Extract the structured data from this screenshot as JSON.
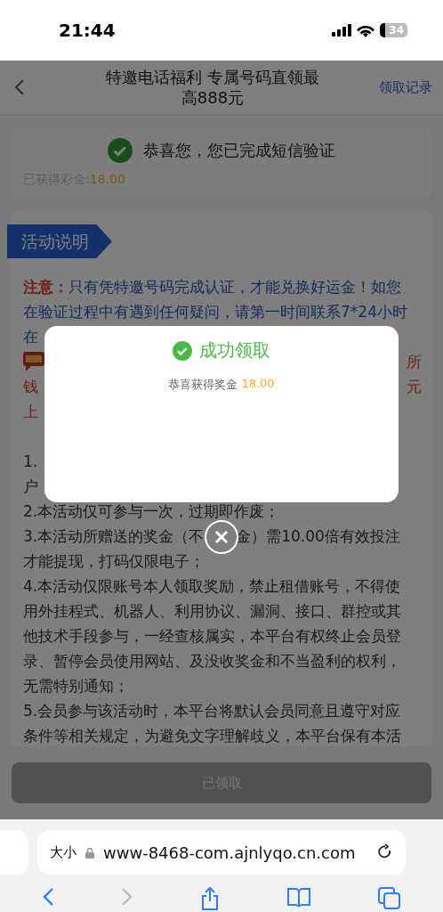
{
  "status_bar": {
    "time": "21:44",
    "battery": "34"
  },
  "nav": {
    "title": "特邀电话福利 专属号码直领最高888元",
    "link": "领取记录"
  },
  "verify_card": {
    "message": "恭喜您，您已完成短信验证",
    "earned_label": "已获得彩金:",
    "earned_value": "18.00"
  },
  "section_label": "活动说明",
  "notice": {
    "label": "注意：",
    "text": "只有凭特邀号码完成认证，才能兑换好运金！如您在验证过程中有遇到任何疑问，请第一时间联系7*24小时在"
  },
  "covered_lines": [
    {
      "kind": "badge",
      "right": "所"
    },
    {
      "kind": "text",
      "left": "钱",
      "right": "元"
    },
    {
      "kind": "text",
      "left": "上"
    }
  ],
  "rule_fragments": [
    "1.",
    "户"
  ],
  "rules": [
    "2.本活动仅可参与一次，过期即作废；",
    {
      "kind": "split",
      "left": "3.本活动所赠送的奖金（不",
      "right": "金）需10.00倍有效投注"
    },
    "才能提现，打码仅限电子；",
    "4.本活动仅限账号本人领取奖励，禁止租借账号，不得使用外挂程式、机器人、利用协议、漏洞、接口、群控或其他技术手段参与，一经查核属实，本平台有权终止会员登录、暂停会员使用网站、及没收奖金和不当盈利的权利，无需特别通知；",
    "5.会员参与该活动时，本平台将默认会员同意且遵守对应条件等相关规定，为避免文字理解歧义，本平台保有本活"
  ],
  "claim_button": {
    "label": "已领取",
    "disabled": true
  },
  "modal": {
    "title": "成功领取",
    "message": "恭喜获得奖金",
    "amount": "18.00"
  },
  "browser": {
    "text_size": "大小",
    "url": "www-8468-com.ajnlyqo.cn.com"
  }
}
